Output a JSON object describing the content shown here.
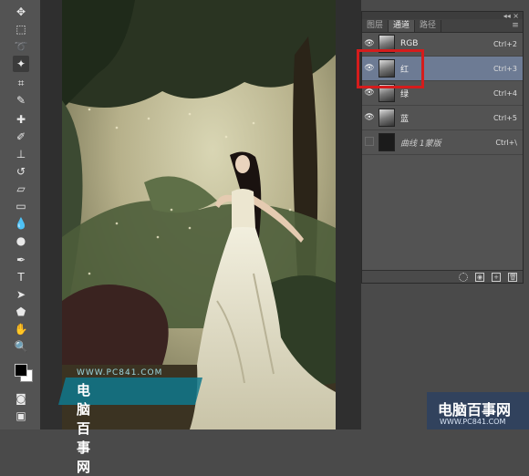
{
  "panel": {
    "top_collapse": "◂◂ ×",
    "tabs": [
      "图层",
      "通道",
      "路径"
    ],
    "active_tab_index": 1,
    "menu_glyph": "≡",
    "channels": [
      {
        "name": "RGB",
        "shortcut": "Ctrl+2",
        "visible": true,
        "selected": false
      },
      {
        "name": "红",
        "shortcut": "Ctrl+3",
        "visible": true,
        "selected": true
      },
      {
        "name": "绿",
        "shortcut": "Ctrl+4",
        "visible": true,
        "selected": false
      },
      {
        "name": "蓝",
        "shortcut": "Ctrl+5",
        "visible": true,
        "selected": false
      },
      {
        "name": "曲线 1蒙版",
        "shortcut": "Ctrl+\\",
        "visible": false,
        "selected": false
      }
    ],
    "footer_icons": [
      "load-selection-icon",
      "save-selection-icon",
      "new-channel-icon",
      "delete-channel-icon"
    ]
  },
  "highlight_color": "#d51c1c",
  "watermark_left": {
    "url": "WWW.PC841.COM",
    "title": "电脑百事网"
  },
  "watermark_right": {
    "title": "电脑百事网",
    "url": "WWW.PC841.COM"
  },
  "tools": [
    "move-tool-icon",
    "marquee-tool-icon",
    "lasso-tool-icon",
    "magic-wand-tool-icon",
    "crop-tool-icon",
    "eyedropper-tool-icon",
    "healing-brush-icon",
    "brush-tool-icon",
    "clone-stamp-icon",
    "history-brush-icon",
    "eraser-tool-icon",
    "gradient-tool-icon",
    "blur-tool-icon",
    "dodge-tool-icon",
    "pen-tool-icon",
    "type-tool-icon",
    "path-selection-icon",
    "shape-tool-icon",
    "hand-tool-icon",
    "zoom-tool-icon"
  ]
}
